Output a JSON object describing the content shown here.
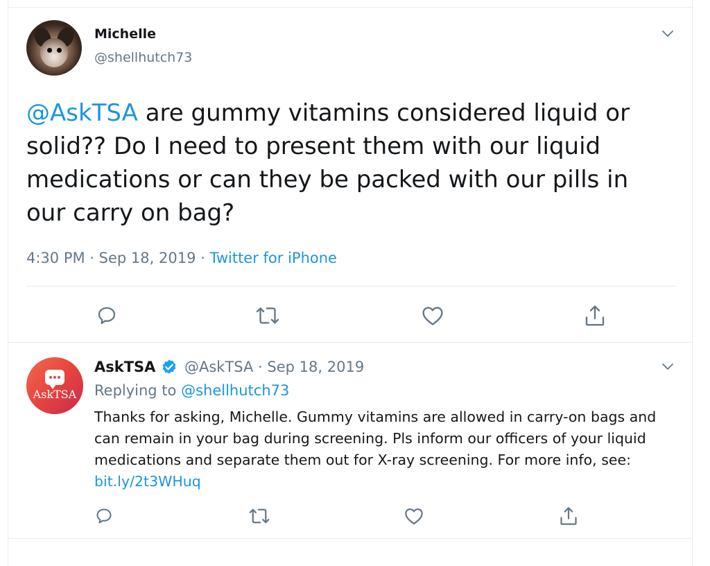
{
  "tweet": {
    "author_name": "Michelle",
    "author_handle": "@shellhutch73",
    "mention": "@AskTSA",
    "text": " are gummy vitamins considered liquid or solid?? Do I need to present them with our liquid medications or can they be packed with our pills in our carry on bag?",
    "time": "4:30 PM",
    "sep1": " · ",
    "date": "Sep 18, 2019",
    "sep2": " · ",
    "source": "Twitter for iPhone"
  },
  "reply": {
    "author_name": "AskTSA",
    "avatar_text": "AskTSA",
    "handle_and_date": "@AskTSA · Sep 18, 2019",
    "replying_prefix": "Replying to ",
    "replying_to": "@shellhutch73",
    "text": "Thanks for asking, Michelle. Gummy vitamins are allowed in carry-on bags and can remain in your bag during screening. Pls inform our officers of your liquid medications and separate them out for X-ray screening. For more info, see: ",
    "link": "bit.ly/2t3WHuq"
  },
  "icons": {
    "caret": "chevron-down-icon",
    "reply": "reply-icon",
    "retweet": "retweet-icon",
    "like": "heart-icon",
    "share": "share-icon",
    "verified": "verified-badge-icon"
  },
  "colors": {
    "link": "#1b95e0",
    "muted": "#657786",
    "text": "#14171a",
    "border": "#e6ecf0",
    "icon": "#657786",
    "asktsa_brand": "#e8473f"
  }
}
